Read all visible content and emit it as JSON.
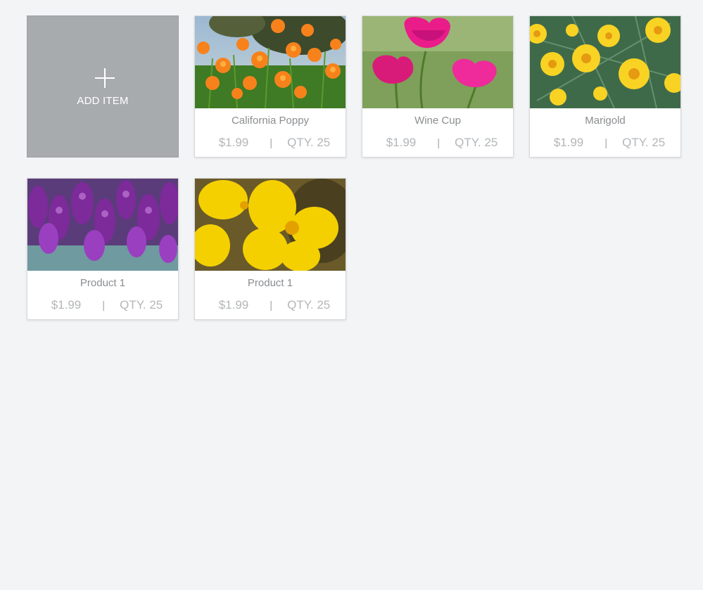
{
  "add_item": {
    "label": "ADD ITEM",
    "icon": "plus-icon"
  },
  "products": [
    {
      "name": "California Poppy",
      "price": "$1.99",
      "separator": "|",
      "qty": "QTY. 25",
      "image": "california-poppy-photo"
    },
    {
      "name": "Wine Cup",
      "price": "$1.99",
      "separator": "|",
      "qty": "QTY. 25",
      "image": "wine-cup-photo"
    },
    {
      "name": "Marigold",
      "price": "$1.99",
      "separator": "|",
      "qty": "QTY. 25",
      "image": "marigold-photo"
    },
    {
      "name": "Product 1",
      "price": "$1.99",
      "separator": "|",
      "qty": "QTY. 25",
      "image": "purple-sage-photo"
    },
    {
      "name": "Product 1",
      "price": "$1.99",
      "separator": "|",
      "qty": "QTY. 25",
      "image": "yellow-flower-photo"
    }
  ],
  "colors": {
    "background": "#f3f4f6",
    "add_card": "#a7abae",
    "card": "#ffffff",
    "name_text": "#8a8d90",
    "meta_text": "#b3b6b9"
  }
}
